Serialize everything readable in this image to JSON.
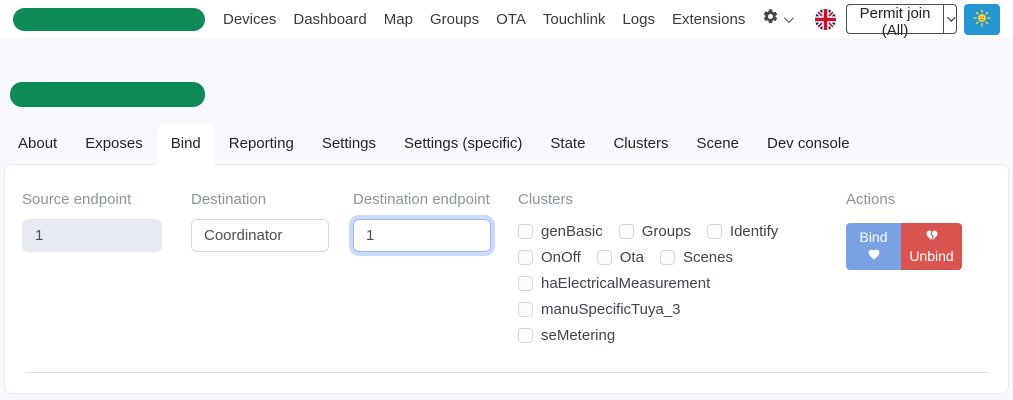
{
  "navbar": {
    "logo_redacted": true,
    "items": [
      "Devices",
      "Dashboard",
      "Map",
      "Groups",
      "OTA",
      "Touchlink",
      "Logs",
      "Extensions"
    ],
    "settings_icon": "gear-icon",
    "language_icon": "uk-flag-icon",
    "permit_join_label": "Permit join (All)",
    "theme_icon": "sun-icon"
  },
  "device": {
    "name_redacted": true
  },
  "tabs": {
    "items": [
      "About",
      "Exposes",
      "Bind",
      "Reporting",
      "Settings",
      "Settings (specific)",
      "State",
      "Clusters",
      "Scene",
      "Dev console"
    ],
    "active": "Bind"
  },
  "bind_form": {
    "source_endpoint": {
      "label": "Source endpoint",
      "value": "1",
      "disabled": true
    },
    "destination": {
      "label": "Destination",
      "value": "Coordinator"
    },
    "destination_endpoint": {
      "label": "Destination endpoint",
      "value": "1",
      "focused": true
    },
    "clusters": {
      "label": "Clusters",
      "options": [
        "genBasic",
        "Groups",
        "Identify",
        "OnOff",
        "Ota",
        "Scenes",
        "haElectricalMeasurement",
        "manuSpecificTuya_3",
        "seMetering"
      ],
      "checked": []
    },
    "actions": {
      "label": "Actions",
      "bind_label": "Bind",
      "bind_icon": "heart-icon",
      "unbind_label": "Unbind",
      "unbind_icon": "broken-heart-icon"
    }
  },
  "colors": {
    "brand_green": "#0e8a57",
    "theme_button_blue": "#2596d1",
    "bind_button_blue": "#7aa1e3",
    "unbind_button_red": "#d9534f",
    "focus_ring": "rgba(82,134,237,0.30)",
    "page_background": "#f7f8fb",
    "muted_label": "#8c959d"
  }
}
